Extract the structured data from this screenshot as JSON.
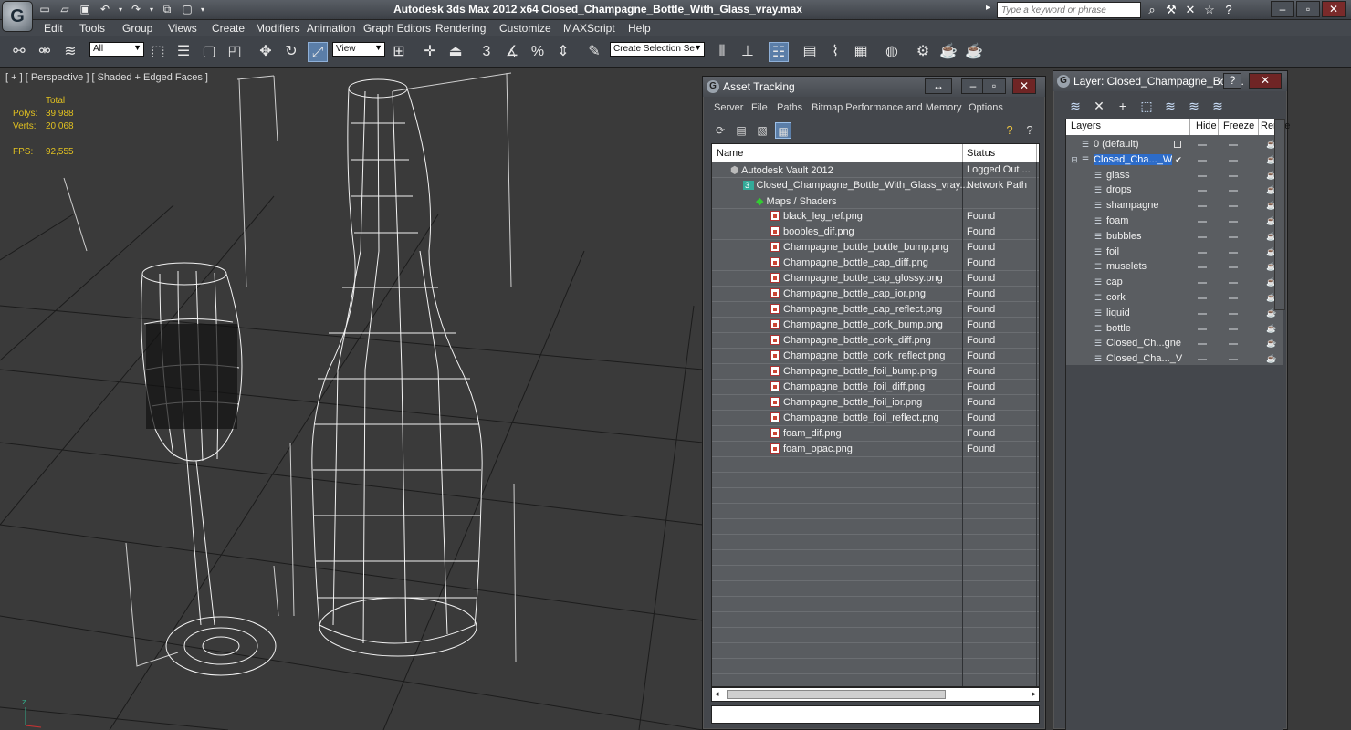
{
  "window": {
    "title": "Autodesk 3ds Max  2012 x64      Closed_Champagne_Bottle_With_Glass_vray.max",
    "logo": "G",
    "search_placeholder": "Type a keyword or phrase"
  },
  "menu": [
    "Edit",
    "Tools",
    "Group",
    "Views",
    "Create",
    "Modifiers",
    "Animation",
    "Graph Editors",
    "Rendering",
    "Customize",
    "MAXScript",
    "Help"
  ],
  "toolbar": {
    "selection_filter": "All",
    "ref_coord": "View",
    "named_selection": "Create Selection Se"
  },
  "viewport": {
    "label": "[ + ] [ Perspective ] [ Shaded + Edged Faces ]",
    "stats": {
      "total_label": "Total",
      "polys_label": "Polys:",
      "polys_value": "39 988",
      "verts_label": "Verts:",
      "verts_value": "20 068",
      "fps_label": "FPS:",
      "fps_value": "92,555"
    }
  },
  "asset_tracking": {
    "title": "Asset Tracking",
    "menu": [
      "Server",
      "File",
      "Paths",
      "Bitmap Performance and Memory",
      "Options"
    ],
    "columns": [
      "Name",
      "Status"
    ],
    "rows": [
      {
        "name": "Autodesk Vault 2012",
        "status": "Logged Out ...",
        "level": 1,
        "icon": "vault-icon"
      },
      {
        "name": "Closed_Champagne_Bottle_With_Glass_vray....",
        "status": "Network Path",
        "level": 2,
        "icon": "max-file-icon"
      },
      {
        "name": "Maps / Shaders",
        "status": "",
        "level": 3,
        "icon": "maps-icon"
      },
      {
        "name": "black_leg_ref.png",
        "status": "Found",
        "level": 4,
        "icon": "png-icon"
      },
      {
        "name": "boobles_dif.png",
        "status": "Found",
        "level": 4,
        "icon": "png-icon"
      },
      {
        "name": "Champagne_bottle_bottle_bump.png",
        "status": "Found",
        "level": 4,
        "icon": "png-icon"
      },
      {
        "name": "Champagne_bottle_cap_diff.png",
        "status": "Found",
        "level": 4,
        "icon": "png-icon"
      },
      {
        "name": "Champagne_bottle_cap_glossy.png",
        "status": "Found",
        "level": 4,
        "icon": "png-icon"
      },
      {
        "name": "Champagne_bottle_cap_ior.png",
        "status": "Found",
        "level": 4,
        "icon": "png-icon"
      },
      {
        "name": "Champagne_bottle_cap_reflect.png",
        "status": "Found",
        "level": 4,
        "icon": "png-icon"
      },
      {
        "name": "Champagne_bottle_cork_bump.png",
        "status": "Found",
        "level": 4,
        "icon": "png-icon"
      },
      {
        "name": "Champagne_bottle_cork_diff.png",
        "status": "Found",
        "level": 4,
        "icon": "png-icon"
      },
      {
        "name": "Champagne_bottle_cork_reflect.png",
        "status": "Found",
        "level": 4,
        "icon": "png-icon"
      },
      {
        "name": "Champagne_bottle_foil_bump.png",
        "status": "Found",
        "level": 4,
        "icon": "png-icon"
      },
      {
        "name": "Champagne_bottle_foil_diff.png",
        "status": "Found",
        "level": 4,
        "icon": "png-icon"
      },
      {
        "name": "Champagne_bottle_foil_ior.png",
        "status": "Found",
        "level": 4,
        "icon": "png-icon"
      },
      {
        "name": "Champagne_bottle_foil_reflect.png",
        "status": "Found",
        "level": 4,
        "icon": "png-icon"
      },
      {
        "name": "foam_dif.png",
        "status": "Found",
        "level": 4,
        "icon": "png-icon"
      },
      {
        "name": "foam_opac.png",
        "status": "Found",
        "level": 4,
        "icon": "png-icon"
      }
    ]
  },
  "layer_window": {
    "title": "Layer: Closed_Champagne_Bottl...",
    "columns": [
      "Layers",
      "Hide",
      "Freeze",
      "Rende"
    ],
    "rows": [
      {
        "name": "0 (default)",
        "level": 0,
        "selected": false,
        "current": false
      },
      {
        "name": "Closed_Cha..._With",
        "level": 0,
        "selected": true,
        "current": true
      },
      {
        "name": "glass",
        "level": 1,
        "selected": false,
        "current": false
      },
      {
        "name": "drops",
        "level": 1,
        "selected": false,
        "current": false
      },
      {
        "name": "shampagne",
        "level": 1,
        "selected": false,
        "current": false
      },
      {
        "name": "foam",
        "level": 1,
        "selected": false,
        "current": false
      },
      {
        "name": "bubbles",
        "level": 1,
        "selected": false,
        "current": false
      },
      {
        "name": "foil",
        "level": 1,
        "selected": false,
        "current": false
      },
      {
        "name": "muselets",
        "level": 1,
        "selected": false,
        "current": false
      },
      {
        "name": "cap",
        "level": 1,
        "selected": false,
        "current": false
      },
      {
        "name": "cork",
        "level": 1,
        "selected": false,
        "current": false
      },
      {
        "name": "liquid",
        "level": 1,
        "selected": false,
        "current": false
      },
      {
        "name": "bottle",
        "level": 1,
        "selected": false,
        "current": false
      },
      {
        "name": "Closed_Ch...gne",
        "level": 1,
        "selected": false,
        "current": false
      },
      {
        "name": "Closed_Cha..._V",
        "level": 1,
        "selected": false,
        "current": false
      }
    ]
  }
}
